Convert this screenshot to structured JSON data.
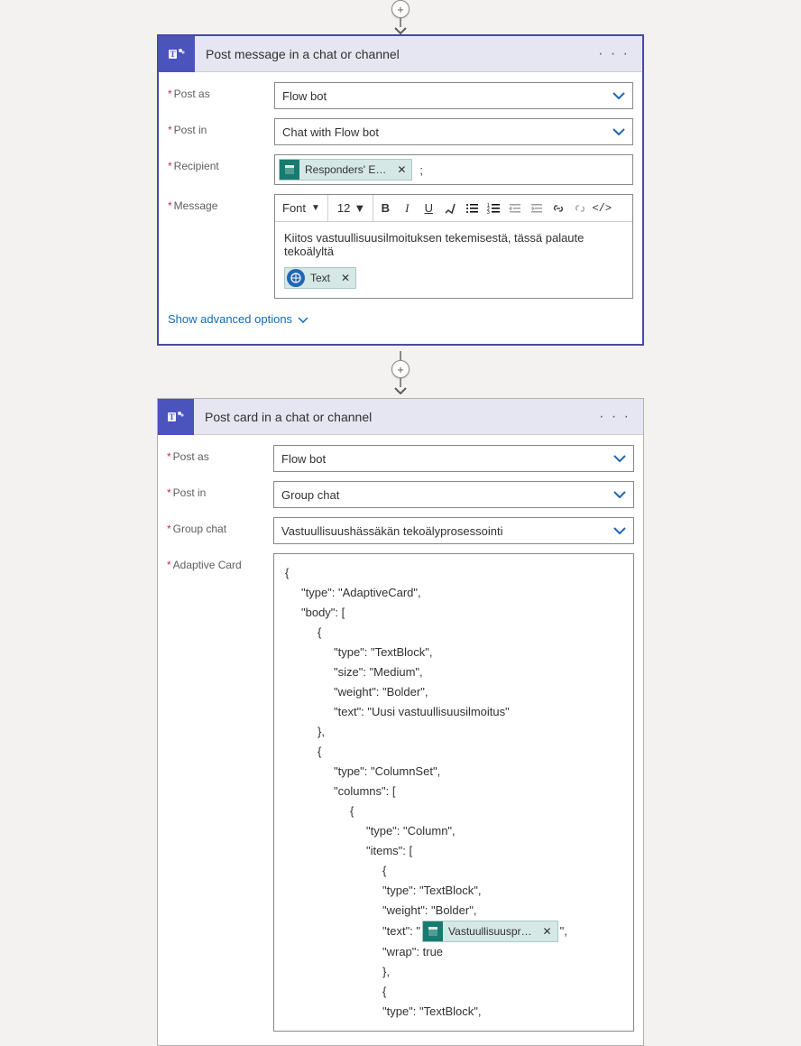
{
  "card1": {
    "title": "Post message in a chat or channel",
    "menu_glyph": "· · ·",
    "fields": {
      "post_as": {
        "label": "Post as",
        "value": "Flow bot"
      },
      "post_in": {
        "label": "Post in",
        "value": "Chat with Flow bot"
      },
      "recipient": {
        "label": "Recipient",
        "token": {
          "label": "Responders' E…"
        },
        "after": ";"
      },
      "message": {
        "label": "Message",
        "toolbar": {
          "font": "Font",
          "size": "12"
        },
        "body_text": "Kiitos vastuullisuusilmoituksen tekemisestä, tässä palaute tekoälyltä",
        "text_token": {
          "label": "Text"
        }
      }
    },
    "advanced": "Show advanced options"
  },
  "card2": {
    "title": "Post card in a chat or channel",
    "menu_glyph": "· · ·",
    "fields": {
      "post_as": {
        "label": "Post as",
        "value": "Flow bot"
      },
      "post_in": {
        "label": "Post in",
        "value": "Group chat"
      },
      "group_chat": {
        "label": "Group chat",
        "value": "Vastuullisuushässäkän tekoälyprosessointi"
      },
      "adaptive_card": {
        "label": "Adaptive Card",
        "lines": {
          "l0": "{",
          "l1": "\"type\": \"AdaptiveCard\",",
          "l2": "\"body\": [",
          "l3": "{",
          "l4": "\"type\": \"TextBlock\",",
          "l5": "\"size\": \"Medium\",",
          "l6": "\"weight\": \"Bolder\",",
          "l7": "\"text\": \"Uusi vastuullisuusilmoitus\"",
          "l8": "},",
          "l9": "{",
          "l10": "\"type\": \"ColumnSet\",",
          "l11": "\"columns\": [",
          "l12": "{",
          "l13": "\"type\": \"Column\",",
          "l14": "\"items\": [",
          "l15": "{",
          "l16": "\"type\": \"TextBlock\",",
          "l17": "\"weight\": \"Bolder\",",
          "text_prefix": "\"text\": \"",
          "text_suffix": "\",",
          "l19": "\"wrap\": true",
          "l20": "},",
          "l21": "{",
          "l22": "\"type\": \"TextBlock\","
        },
        "embedded_token": {
          "label": "Vastuullisuuspr…"
        }
      }
    }
  },
  "plus_glyph": "+"
}
